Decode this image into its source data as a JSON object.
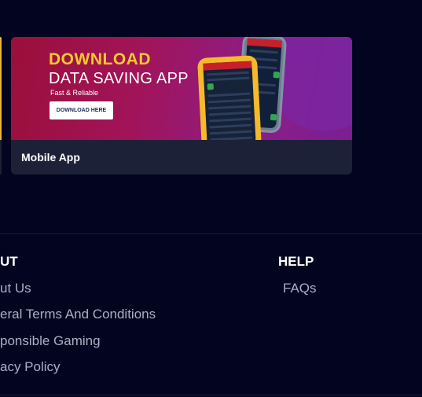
{
  "promo": {
    "banner_title": "DOWNLOAD",
    "banner_subtitle": "DATA SAVING APP",
    "banner_tagline": "Fast & Reliable",
    "banner_button": "DOWNLOAD HERE",
    "caption": "Mobile App"
  },
  "footer": {
    "about": {
      "heading": "UT",
      "links": [
        "ut Us",
        "eral Terms And Conditions",
        "ponsible Gaming",
        "acy Policy"
      ]
    },
    "help": {
      "heading": "HELP",
      "links": [
        "FAQs"
      ]
    }
  },
  "colors": {
    "background": "#03041f",
    "card": "#1c2138",
    "accent_yellow": "#f6c928",
    "link": "#a9afc4"
  }
}
